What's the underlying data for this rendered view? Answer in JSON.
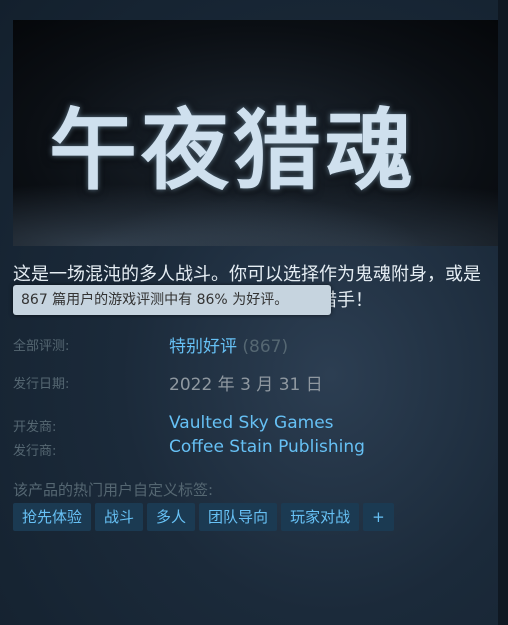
{
  "hero": {
    "title": "午夜猎魂"
  },
  "description": "这是一场混沌的多人战斗。你可以选择作为鬼魂附身，或是作为一名装备精良、持枪猎杀灰鬼魂的猎手！",
  "tooltip": "867 篇用户的游戏评测中有 86% 为好评。",
  "reviews": {
    "label": "全部评测:",
    "value": "特别好评",
    "count": "(867)"
  },
  "release": {
    "label": "发行日期:",
    "value": "2022 年 3 月 31 日"
  },
  "developer": {
    "label": "开发商:",
    "value": "Vaulted Sky Games"
  },
  "publisher": {
    "label": "发行商:",
    "value": "Coffee Stain Publishing"
  },
  "tags": {
    "header": "该产品的热门用户自定义标签:",
    "items": [
      "抢先体验",
      "战斗",
      "多人",
      "团队导向",
      "玩家对战",
      "+"
    ]
  }
}
